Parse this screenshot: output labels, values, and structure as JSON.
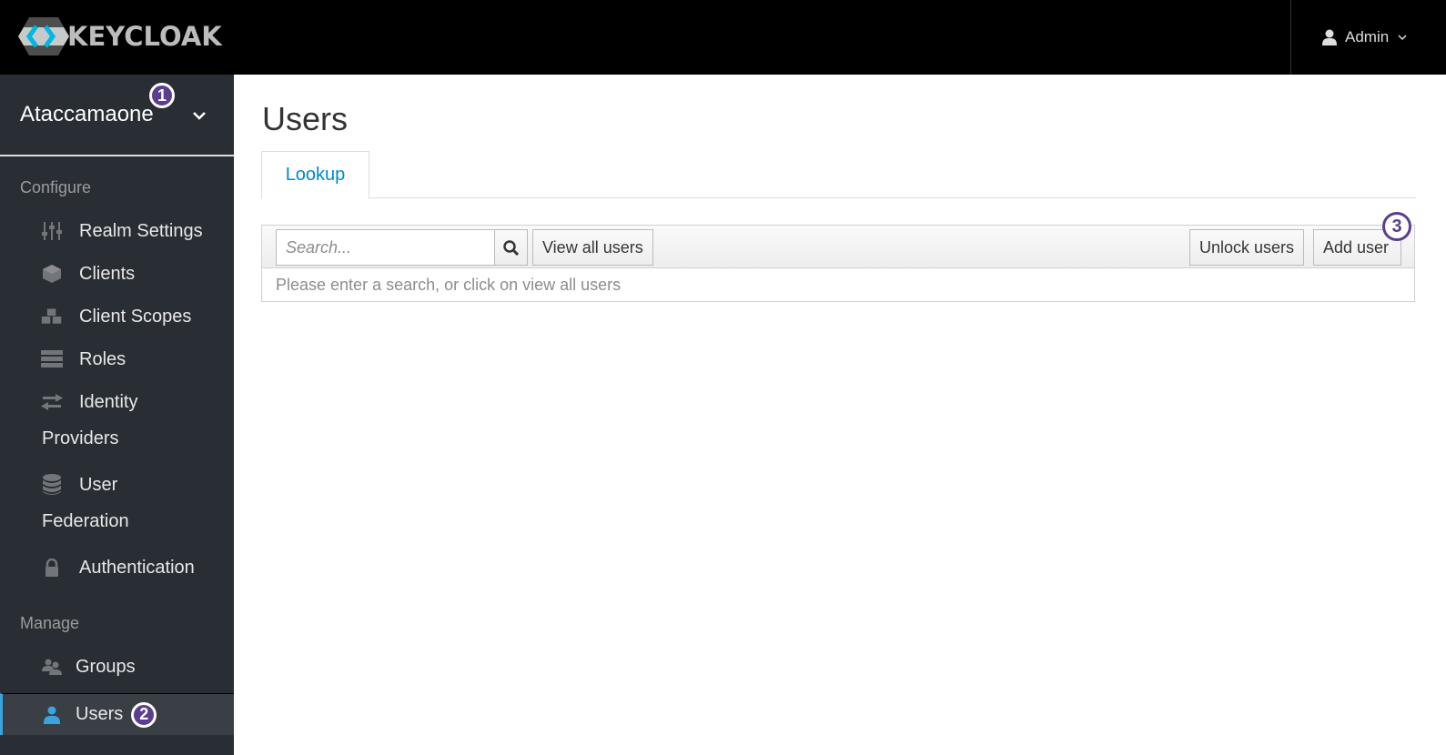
{
  "header": {
    "logo_text": "KEYCLOAK",
    "user_menu_label": "Admin",
    "icons": {
      "user": "user-icon",
      "chevron": "chevron-down-icon"
    }
  },
  "sidebar": {
    "realm_name": "Ataccamaone",
    "realm_badge": "1",
    "sections": [
      {
        "label": "Configure",
        "items": [
          {
            "label": "Realm Settings",
            "icon": "sliders-icon"
          },
          {
            "label": "Clients",
            "icon": "cube-icon"
          },
          {
            "label": "Client Scopes",
            "icon": "cubes-icon"
          },
          {
            "label": "Roles",
            "icon": "server-icon"
          },
          {
            "label": "Identity",
            "label_wrap": "Providers",
            "icon": "exchange-icon"
          },
          {
            "label": "User",
            "label_wrap": "Federation",
            "icon": "database-icon"
          },
          {
            "label": "Authentication",
            "icon": "lock-icon"
          }
        ]
      },
      {
        "label": "Manage",
        "items": [
          {
            "label": "Groups",
            "icon": "users-icon"
          },
          {
            "label": "Users",
            "icon": "user-icon",
            "active": true,
            "badge": "2"
          }
        ]
      }
    ]
  },
  "main": {
    "title": "Users",
    "tabs": [
      {
        "label": "Lookup",
        "active": true
      }
    ],
    "toolbar": {
      "search_placeholder": "Search...",
      "search_value": "",
      "view_all_label": "View all users",
      "unlock_label": "Unlock users",
      "add_user_label": "Add user",
      "add_user_badge": "3"
    },
    "empty_message": "Please enter a search, or click on view all users"
  },
  "colors": {
    "topbar": "#000000",
    "sidebar": "#292e34",
    "active_accent": "#39a5dc",
    "link": "#0088ce",
    "badge": "#5a3f8f"
  }
}
